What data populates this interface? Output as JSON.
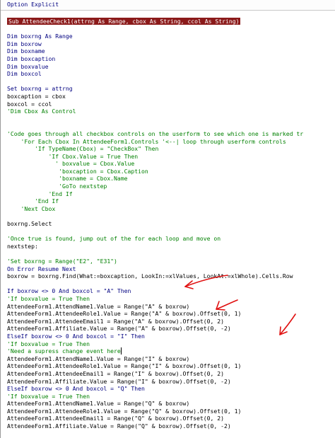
{
  "window": {
    "declarations": "Option Explicit"
  },
  "code_lines": [
    {
      "t": "Sub AttendeeCheck1(attrng As Range, cbox As String, ccol As String)",
      "c": "hl"
    },
    {
      "t": "",
      "c": ""
    },
    {
      "t": "Dim boxrng As Range",
      "c": "kw"
    },
    {
      "t": "Dim boxrow",
      "c": "kw"
    },
    {
      "t": "Dim boxname",
      "c": "kw"
    },
    {
      "t": "Dim boxcaption",
      "c": "kw"
    },
    {
      "t": "Dim boxvalue",
      "c": "kw"
    },
    {
      "t": "Dim boxcol",
      "c": "kw"
    },
    {
      "t": "",
      "c": ""
    },
    {
      "t": "Set boxrng = attrng",
      "c": "kw"
    },
    {
      "t": "boxcaption = cbox",
      "c": ""
    },
    {
      "t": "boxcol = ccol",
      "c": ""
    },
    {
      "t": "'Dim Cbox As Control",
      "c": "cmt"
    },
    {
      "t": "",
      "c": ""
    },
    {
      "t": "",
      "c": ""
    },
    {
      "t": "'Code goes through all checkbox controls on the userform to see which one is marked tr",
      "c": "cmt"
    },
    {
      "t": "    'For Each Cbox In AttendeeForm1.Controls '<--| loop through userform controls",
      "c": "cmt"
    },
    {
      "t": "        'If TypeName(Cbox) = \"CheckBox\" Then",
      "c": "cmt"
    },
    {
      "t": "            'If Cbox.Value = True Then",
      "c": "cmt"
    },
    {
      "t": "              ' boxvalue = Cbox.Value",
      "c": "cmt"
    },
    {
      "t": "               'boxcaption = Cbox.Caption",
      "c": "cmt"
    },
    {
      "t": "               'boxname = Cbox.Name",
      "c": "cmt"
    },
    {
      "t": "               'GoTo nextstep",
      "c": "cmt"
    },
    {
      "t": "            'End If",
      "c": "cmt"
    },
    {
      "t": "        'End If",
      "c": "cmt"
    },
    {
      "t": "    'Next Cbox",
      "c": "cmt"
    },
    {
      "t": "",
      "c": ""
    },
    {
      "t": "boxrng.Select",
      "c": ""
    },
    {
      "t": "",
      "c": ""
    },
    {
      "t": "'Once true is found, jump out of the for each loop and move on",
      "c": "cmt"
    },
    {
      "t": "nextstep:",
      "c": ""
    },
    {
      "t": "",
      "c": ""
    },
    {
      "t": "'Set boxrng = Range(\"E2\", \"E31\")",
      "c": "cmt"
    },
    {
      "t": "On Error Resume Next",
      "c": "kw"
    },
    {
      "t": "boxrow = boxrng.Find(What:=boxcaption, LookIn:=xlValues, LookAt:=xlWhole).Cells.Row",
      "c": ""
    },
    {
      "t": "",
      "c": ""
    },
    {
      "t": "If boxrow <> 0 And boxcol = \"A\" Then",
      "c": "kw"
    },
    {
      "t": "'If boxvalue = True Then",
      "c": "cmt"
    },
    {
      "t": "AttendeeForm1.AttendName1.Value = Range(\"A\" & boxrow)",
      "c": ""
    },
    {
      "t": "AttendeeForm1.AttendeeRole1.Value = Range(\"A\" & boxrow).Offset(0, 1)",
      "c": ""
    },
    {
      "t": "AttendeeForm1.AttendeeEmail1 = Range(\"A\" & boxrow).Offset(0, 2)",
      "c": ""
    },
    {
      "t": "AttendeeForm1.Affiliate.Value = Range(\"A\" & boxrow).Offset(0, -2)",
      "c": ""
    },
    {
      "t": "ElseIf boxrow <> 0 And boxcol = \"I\" Then",
      "c": "kw"
    },
    {
      "t": "'If boxvalue = True Then",
      "c": "cmt"
    },
    {
      "t": "'Need a supress change event here",
      "c": "cmt",
      "cursor": true
    },
    {
      "t": "AttendeeForm1.AttendName1.Value = Range(\"I\" & boxrow)",
      "c": ""
    },
    {
      "t": "AttendeeForm1.AttendeeRole1.Value = Range(\"I\" & boxrow).Offset(0, 1)",
      "c": ""
    },
    {
      "t": "AttendeeForm1.AttendeeEmail1 = Range(\"I\" & boxrow).Offset(0, 2)",
      "c": ""
    },
    {
      "t": "AttendeeForm1.Affiliate.Value = Range(\"I\" & boxrow).Offset(0, -2)",
      "c": ""
    },
    {
      "t": "ElseIf boxrow <> 0 And boxcol = \"Q\" Then",
      "c": "kw"
    },
    {
      "t": "'If boxvalue = True Then",
      "c": "cmt"
    },
    {
      "t": "AttendeeForm1.AttendName1.Value = Range(\"Q\" & boxrow)",
      "c": ""
    },
    {
      "t": "AttendeeForm1.AttendeeRole1.Value = Range(\"Q\" & boxrow).Offset(0, 1)",
      "c": ""
    },
    {
      "t": "AttendeeForm1.AttendeeEmail1 = Range(\"Q\" & boxrow).Offset(0, 2)",
      "c": ""
    },
    {
      "t": "AttendeeForm1.Affiliate.Value = Range(\"Q\" & boxrow).Offset(0, -2)",
      "c": ""
    }
  ],
  "colors": {
    "keyword": "#000080",
    "comment": "#008000",
    "highlight_bg": "#8b1a1a",
    "annotation": "#e01010"
  },
  "annotations": [
    "red-arrow",
    "red-arrow",
    "red-arrow"
  ]
}
